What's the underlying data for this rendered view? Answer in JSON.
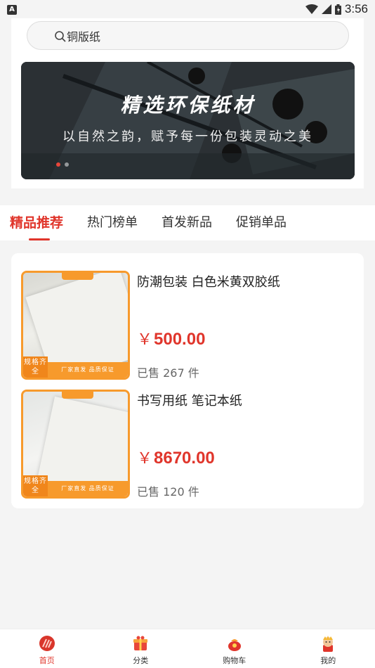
{
  "status_bar": {
    "left_badge": "A",
    "time": "3:56"
  },
  "search": {
    "text": "铜版纸"
  },
  "banner": {
    "title": "精选环保纸材",
    "subtitle": "以自然之韵，赋予每一份包装灵动之美"
  },
  "tabs": [
    {
      "label": "精品推荐"
    },
    {
      "label": "热门榜单"
    },
    {
      "label": "首发新品"
    },
    {
      "label": "促销单品"
    }
  ],
  "products": [
    {
      "name": "防潮包装 白色米黄双胶纸",
      "currency": "￥",
      "price": "500.00",
      "sold": "已售 267 件",
      "badge": "规格齐全",
      "strip": "厂家直发 品质保证"
    },
    {
      "name": "书写用纸 笔记本纸",
      "currency": "￥",
      "price": "8670.00",
      "sold": "已售 120 件",
      "badge": "规格齐全",
      "strip": "厂家直发 品质保证"
    }
  ],
  "bottom_nav": [
    {
      "label": "首页",
      "icon": "home-icon"
    },
    {
      "label": "分类",
      "icon": "category-gift-icon"
    },
    {
      "label": "购物车",
      "icon": "cart-bag-icon"
    },
    {
      "label": "我的",
      "icon": "profile-icon"
    }
  ],
  "colors": {
    "accent": "#e0352b",
    "thumb_border": "#f79a2c"
  }
}
